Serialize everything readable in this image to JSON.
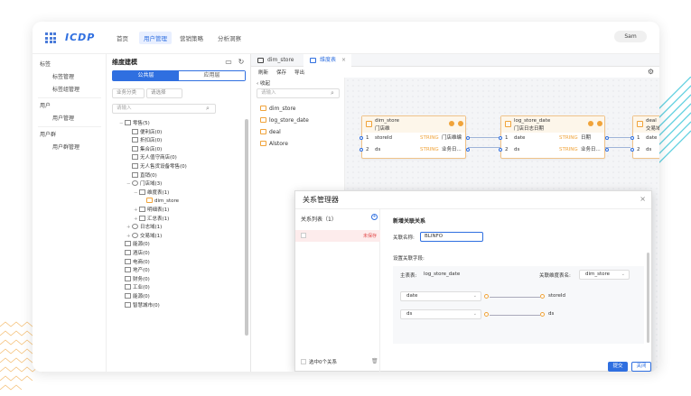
{
  "app": {
    "logo": "ICDP",
    "user": "Sam"
  },
  "topnav": {
    "items": [
      "首页",
      "用户管理",
      "营销策略",
      "分析洞察"
    ],
    "active_index": 1
  },
  "leftnav": {
    "groups": [
      {
        "label": "标签",
        "items": [
          "标签管理",
          "标签组管理"
        ]
      },
      {
        "label": "用户",
        "items": [
          "用户管理"
        ]
      },
      {
        "label": "用户群",
        "items": [
          "用户群管理"
        ]
      }
    ]
  },
  "dim_panel": {
    "title": "维度建模",
    "segments": [
      "公共层",
      "应用层"
    ],
    "active_segment": 0,
    "filter_select": "业务分类",
    "filter_select2": "请选择",
    "search_placeholder": "请输入",
    "tree": [
      {
        "label": "零售(5)",
        "level": 0,
        "toggle": "-",
        "icon": "box"
      },
      {
        "label": "便利店(0)",
        "level": 1,
        "toggle": "",
        "icon": "box"
      },
      {
        "label": "折扣店(0)",
        "level": 1,
        "toggle": "",
        "icon": "box"
      },
      {
        "label": "集合店(0)",
        "level": 1,
        "toggle": "",
        "icon": "box"
      },
      {
        "label": "无人值守商店(0)",
        "level": 1,
        "toggle": "",
        "icon": "box"
      },
      {
        "label": "无人售货设备零售(0)",
        "level": 1,
        "toggle": "",
        "icon": "box"
      },
      {
        "label": "直销(0)",
        "level": 1,
        "toggle": "",
        "icon": "box"
      },
      {
        "label": "门店域(3)",
        "level": 1,
        "toggle": "-",
        "icon": "globe"
      },
      {
        "label": "维度表(1)",
        "level": 2,
        "toggle": "-",
        "icon": "box"
      },
      {
        "label": "dim_store",
        "level": 3,
        "toggle": "",
        "icon": "folder"
      },
      {
        "label": "明细表(1)",
        "level": 2,
        "toggle": "+",
        "icon": "box"
      },
      {
        "label": "汇总表(1)",
        "level": 2,
        "toggle": "+",
        "icon": "box"
      },
      {
        "label": "日志域(1)",
        "level": 1,
        "toggle": "+",
        "icon": "globe"
      },
      {
        "label": "交易域(1)",
        "level": 1,
        "toggle": "+",
        "icon": "globe"
      },
      {
        "label": "能源(0)",
        "level": 0,
        "toggle": "",
        "icon": "box"
      },
      {
        "label": "酒店(0)",
        "level": 0,
        "toggle": "",
        "icon": "box"
      },
      {
        "label": "电商(0)",
        "level": 0,
        "toggle": "",
        "icon": "box"
      },
      {
        "label": "地产(0)",
        "level": 0,
        "toggle": "",
        "icon": "box"
      },
      {
        "label": "财务(0)",
        "level": 0,
        "toggle": "",
        "icon": "box"
      },
      {
        "label": "工业(0)",
        "level": 0,
        "toggle": "",
        "icon": "box"
      },
      {
        "label": "能源(0)",
        "level": 0,
        "toggle": "",
        "icon": "box"
      },
      {
        "label": "智慧城市(0)",
        "level": 0,
        "toggle": "",
        "icon": "box"
      }
    ]
  },
  "work": {
    "tabs": [
      {
        "label": "dim_store",
        "closable": false
      },
      {
        "label": "维度表",
        "closable": true
      }
    ],
    "active_tab": 1,
    "toolbar": [
      "刷新",
      "保存",
      "导出"
    ],
    "table_panel": {
      "collapse_label": "收起",
      "search_placeholder": "请输入",
      "tables": [
        "dim_store",
        "log_store_date",
        "deal",
        "Alstore"
      ]
    },
    "nodes": [
      {
        "name": "dim_store",
        "subtitle": "门店维",
        "rows": [
          {
            "idx": "1",
            "field": "storeId",
            "type": "STRING",
            "desc": "门店维编"
          },
          {
            "idx": "2",
            "field": "ds",
            "type": "STRING",
            "desc": "业务日..."
          }
        ]
      },
      {
        "name": "log_store_date",
        "subtitle": "门店日志日期",
        "rows": [
          {
            "idx": "1",
            "field": "date",
            "type": "STRING",
            "desc": "日期"
          },
          {
            "idx": "2",
            "field": "ds",
            "type": "STRING",
            "desc": "业务日..."
          }
        ]
      },
      {
        "name": "deal",
        "subtitle": "交易域数据",
        "rows": [
          {
            "idx": "1",
            "field": "date",
            "type": "",
            "desc": ""
          },
          {
            "idx": "2",
            "field": "ds",
            "type": "",
            "desc": ""
          }
        ]
      }
    ]
  },
  "modal": {
    "title": "关系管理器",
    "list_header": "关系列表（1）",
    "row_status": "未保存",
    "select_all": "选中0个关系",
    "form": {
      "heading": "新增关联关系",
      "name_label": "关联名称:",
      "name_value": "BLINFO",
      "fields_label": "设置关联字段:",
      "main_table_label": "主表表:",
      "main_table_value": "log_store_date",
      "dim_table_label": "关联维度表名:",
      "dim_table_value": "dim_store",
      "mappings": [
        {
          "left": "date",
          "right": "storeId"
        },
        {
          "left": "ds",
          "right": "ds"
        }
      ]
    },
    "confirm": "提交",
    "cancel": "关闭"
  },
  "colors": {
    "accent": "#2f6fe0",
    "node_border": "#f0c38a",
    "warning": "#e24b4b"
  }
}
